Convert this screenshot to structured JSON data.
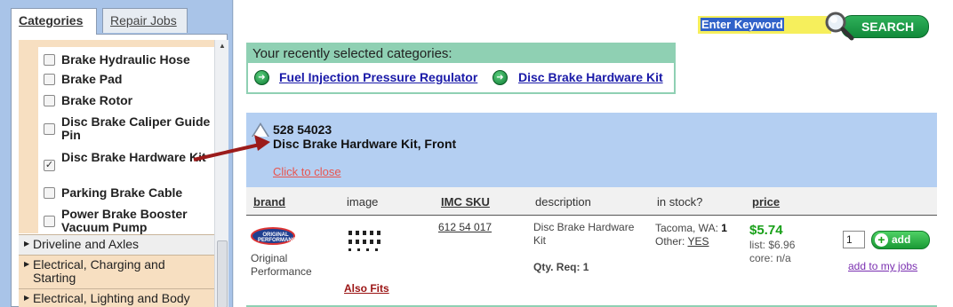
{
  "sidebar": {
    "tabs": [
      {
        "label": "Categories",
        "active": true
      },
      {
        "label": "Repair Jobs",
        "active": false
      }
    ],
    "subcategories": [
      {
        "label": "Brake Hydraulic Hose",
        "checked": false
      },
      {
        "label": "Brake Pad",
        "checked": false
      },
      {
        "label": "Brake Rotor",
        "checked": false
      },
      {
        "label": "Disc Brake Caliper Guide Pin",
        "checked": false
      },
      {
        "label": "Disc Brake Hardware Kit",
        "checked": true
      },
      {
        "label": "Parking Brake Cable",
        "checked": false
      },
      {
        "label": "Power Brake Booster Vacuum Pump",
        "checked": false
      }
    ],
    "categories": [
      {
        "label": "Driveline and Axles"
      },
      {
        "label": "Electrical, Charging and Starting"
      },
      {
        "label": "Electrical, Lighting and Body"
      }
    ]
  },
  "search": {
    "placeholder": "Enter Keyword",
    "button_label": "SEARCH"
  },
  "recent": {
    "heading": "Your recently selected categories:",
    "items": [
      "Fuel Injection Pressure Regulator",
      "Disc Brake Hardware Kit"
    ]
  },
  "product": {
    "part_number": "528 54023",
    "name": "Disc Brake Hardware Kit,  Front",
    "close_label": "Click to close"
  },
  "table": {
    "headers": {
      "brand": "brand",
      "image": "image",
      "imc_sku": "IMC SKU",
      "description": "description",
      "in_stock": "in stock?",
      "price": "price"
    },
    "row": {
      "brand_logo_text": "ORIGINAL PERFORMANCE",
      "brand_name": "Original Performance",
      "also_fits": "Also Fits",
      "sku": "612 54 017",
      "description": "Disc Brake Hardware Kit",
      "qty_req": "Qty. Req: 1",
      "stock_location": "Tacoma, WA:",
      "stock_count": "1",
      "stock_other_label": "Other:",
      "stock_other_value": "YES",
      "price": "$5.74",
      "list_price": "list: $6.96",
      "core": "core: n/a",
      "qty_value": "1",
      "add_label": "add",
      "add_to_jobs": "add to my jobs"
    }
  },
  "colors": {
    "accent_green": "#19a019",
    "header_blue": "#b4cff2",
    "recent_green": "#8fd0b3",
    "annotation_arrow": "#9b1b1b"
  }
}
